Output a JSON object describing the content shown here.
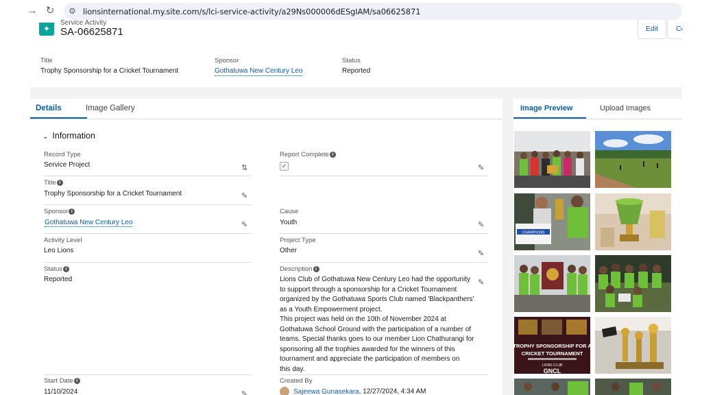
{
  "browser": {
    "back_icon": "arrow-left-icon",
    "reload_icon": "reload-icon",
    "url": "lionsinternational.my.site.com/s/lci-service-activity/a29Ns000006dESgIAM/sa06625871"
  },
  "record": {
    "object_label": "Service Activity",
    "name": "SA-06625871",
    "edit_label": "Edit",
    "more_label": "Co",
    "highlights": {
      "title_label": "Title",
      "title_value": "Trophy Sponsorship for a Cricket Tournament",
      "sponsor_label": "Sponsor",
      "sponsor_value": "Gothatuwa New Century Leo",
      "status_label": "Status",
      "status_value": "Reported"
    }
  },
  "tabs": {
    "details": "Details",
    "gallery": "Image Gallery"
  },
  "section": {
    "title": "Information"
  },
  "fields": {
    "record_type_label": "Record Type",
    "record_type_value": "Service Project",
    "report_complete_label": "Report Complete",
    "report_complete_checked": true,
    "title_label": "Title",
    "title_value": "Trophy Sponsorship for a Cricket Tournament",
    "sponsor_label": "Sponsor",
    "sponsor_value": "Gothatuwa New Century Leo",
    "cause_label": "Cause",
    "cause_value": "Youth",
    "activity_level_label": "Activity Level",
    "activity_level_value": "Leo Lions",
    "project_type_label": "Project Type",
    "project_type_value": "Other",
    "status_label": "Status",
    "status_value": "Reported",
    "description_label": "Description",
    "description_lines": [
      "Lions Club of Gothatuwa New Century Leo had the opportunity",
      "to support through a sponsorship for a Cricket Tournament",
      "organized by the Gothatuwa Sports Club named 'Blackpanthers'",
      "as a Youth Empowerment project.",
      "This project was held on the 10th of November 2024 at",
      "Gothatuwa School Ground with the participation of a number of",
      "teams. Special thanks goes to our member Lion Chathurangi for",
      "sponsoring all the trophies awarded for the winners of this",
      "tournament and appreciate the participation of members on",
      "this day."
    ],
    "start_date_label": "Start Date",
    "start_date_value": "11/10/2024",
    "created_by_label": "Created By",
    "created_by_name": "Sajeewa Gunasekara",
    "created_by_date": ", 12/27/2024, 4:34 AM"
  },
  "right_tabs": {
    "preview": "Image Preview",
    "upload": "Upload Images"
  },
  "gallery": {
    "thumb_text_1": "TROPHY SPONSORSHIP FOR A",
    "thumb_text_2": "CRICKET TOURNAMENT",
    "thumb_text_3": "LIONS CLUB",
    "thumb_text_4": "GNCL",
    "thumb_banner": "CHAMPIONS"
  },
  "colors": {
    "brand": "#0b5cab",
    "object_icon": "#06a59a",
    "page_background": "#f3f3f3"
  }
}
